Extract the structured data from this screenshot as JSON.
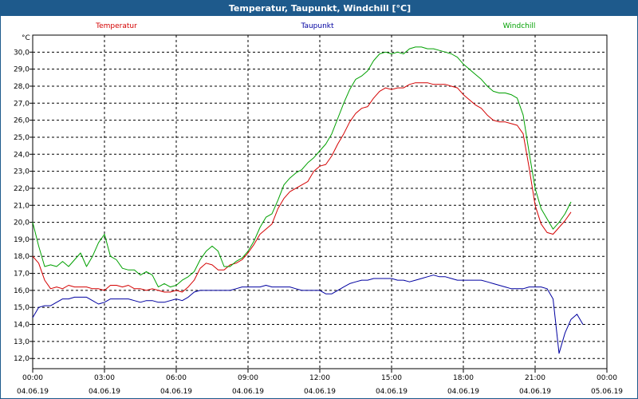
{
  "window": {
    "title": "Temperatur, Taupunkt, Windchill [°C]"
  },
  "colors": {
    "temperature": "#d40000",
    "dewpoint": "#0000a0",
    "windchill": "#00a000",
    "grid": "#000000",
    "titlebar": "#1e5a8c"
  },
  "chart_data": {
    "type": "line",
    "title": "Temperatur, Taupunkt, Windchill [°C]",
    "ylabel": "°C",
    "ylim": [
      11.4,
      31.0
    ],
    "xlim": [
      0,
      24
    ],
    "grid": true,
    "legend_position": "top",
    "y_ticks": [
      "12,0",
      "13,0",
      "14,0",
      "15,0",
      "16,0",
      "17,0",
      "18,0",
      "19,0",
      "20,0",
      "21,0",
      "22,0",
      "23,0",
      "24,0",
      "25,0",
      "26,0",
      "27,0",
      "28,0",
      "29,0",
      "30,0"
    ],
    "x_ticks": [
      {
        "time": "00:00",
        "date": "04.06.19"
      },
      {
        "time": "03:00",
        "date": "04.06.19"
      },
      {
        "time": "06:00",
        "date": "04.06.19"
      },
      {
        "time": "09:00",
        "date": "04.06.19"
      },
      {
        "time": "12:00",
        "date": "04.06.19"
      },
      {
        "time": "15:00",
        "date": "04.06.19"
      },
      {
        "time": "18:00",
        "date": "04.06.19"
      },
      {
        "time": "21:00",
        "date": "04.06.19"
      },
      {
        "time": "00:00",
        "date": "05.06.19"
      }
    ],
    "x_hours": [
      0,
      0.25,
      0.5,
      0.75,
      1,
      1.25,
      1.5,
      1.75,
      2,
      2.25,
      2.5,
      2.75,
      3,
      3.25,
      3.5,
      3.75,
      4,
      4.25,
      4.5,
      4.75,
      5,
      5.25,
      5.5,
      5.75,
      6,
      6.25,
      6.5,
      6.75,
      7,
      7.25,
      7.5,
      7.75,
      8,
      8.25,
      8.5,
      8.75,
      9,
      9.25,
      9.5,
      9.75,
      10,
      10.25,
      10.5,
      10.75,
      11,
      11.25,
      11.5,
      11.75,
      12,
      12.25,
      12.5,
      12.75,
      13,
      13.25,
      13.5,
      13.75,
      14,
      14.25,
      14.5,
      14.75,
      15,
      15.25,
      15.5,
      15.75,
      16,
      16.25,
      16.5,
      16.75,
      17,
      17.25,
      17.5,
      17.75,
      18,
      18.25,
      18.5,
      18.75,
      19,
      19.25,
      19.5,
      19.75,
      20,
      20.25,
      20.5,
      20.75,
      21,
      21.25,
      21.5,
      21.75,
      22,
      22.25,
      22.5,
      22.75,
      23,
      23.25,
      23.5,
      23.75,
      24
    ],
    "series": [
      {
        "name": "Temperatur",
        "color": "#d40000",
        "values": [
          18.0,
          17.6,
          16.6,
          16.1,
          16.2,
          16.1,
          16.3,
          16.2,
          16.2,
          16.2,
          16.1,
          16.1,
          16.0,
          16.3,
          16.3,
          16.2,
          16.3,
          16.1,
          16.1,
          16.0,
          16.1,
          16.0,
          15.9,
          15.9,
          16.0,
          15.9,
          16.2,
          16.6,
          17.3,
          17.6,
          17.5,
          17.2,
          17.2,
          17.5,
          17.6,
          17.8,
          18.2,
          18.7,
          19.3,
          19.6,
          19.9,
          20.8,
          21.4,
          21.8,
          22.0,
          22.2,
          22.4,
          23.0,
          23.3,
          23.4,
          23.9,
          24.6,
          25.2,
          25.9,
          26.4,
          26.7,
          26.8,
          27.3,
          27.7,
          27.9,
          27.8,
          27.9,
          27.9,
          28.1,
          28.2,
          28.2,
          28.2,
          28.1,
          28.1,
          28.1,
          28.0,
          27.9,
          27.5,
          27.2,
          26.9,
          26.7,
          26.3,
          26.0,
          25.9,
          25.9,
          25.8,
          25.7,
          25.2,
          23.2,
          21.0,
          19.9,
          19.4,
          19.3,
          19.7,
          20.1,
          20.6
        ]
      },
      {
        "name": "Taupunkt",
        "color": "#0000a0",
        "values": [
          14.4,
          15.0,
          15.1,
          15.1,
          15.3,
          15.5,
          15.5,
          15.6,
          15.6,
          15.6,
          15.4,
          15.2,
          15.3,
          15.5,
          15.5,
          15.5,
          15.5,
          15.4,
          15.3,
          15.4,
          15.4,
          15.3,
          15.3,
          15.4,
          15.5,
          15.4,
          15.6,
          15.9,
          16.0,
          16.0,
          16.0,
          16.0,
          16.0,
          16.0,
          16.1,
          16.2,
          16.2,
          16.2,
          16.2,
          16.3,
          16.2,
          16.2,
          16.2,
          16.2,
          16.1,
          16.0,
          16.0,
          16.0,
          16.0,
          15.8,
          15.8,
          16.0,
          16.2,
          16.4,
          16.5,
          16.6,
          16.6,
          16.7,
          16.7,
          16.7,
          16.7,
          16.6,
          16.6,
          16.5,
          16.6,
          16.7,
          16.8,
          16.9,
          16.8,
          16.8,
          16.7,
          16.6,
          16.6,
          16.6,
          16.6,
          16.6,
          16.5,
          16.4,
          16.3,
          16.2,
          16.1,
          16.1,
          16.1,
          16.2,
          16.2,
          16.2,
          16.1,
          15.5,
          12.3,
          13.5,
          14.3,
          14.6,
          14.0
        ]
      },
      {
        "name": "Windchill",
        "color": "#00a000",
        "values": [
          20.0,
          18.6,
          17.4,
          17.5,
          17.4,
          17.7,
          17.4,
          17.8,
          18.2,
          17.4,
          18.0,
          18.8,
          19.3,
          18.0,
          17.8,
          17.3,
          17.2,
          17.2,
          16.9,
          17.1,
          16.9,
          16.2,
          16.4,
          16.2,
          16.3,
          16.6,
          16.8,
          17.1,
          17.8,
          18.3,
          18.6,
          18.3,
          17.4,
          17.4,
          17.7,
          17.9,
          18.3,
          18.9,
          19.7,
          20.3,
          20.5,
          21.3,
          22.2,
          22.6,
          22.9,
          23.1,
          23.5,
          23.8,
          24.2,
          24.6,
          25.2,
          26.1,
          27.0,
          27.8,
          28.4,
          28.6,
          28.9,
          29.5,
          29.9,
          30.0,
          29.9,
          30.0,
          29.9,
          30.2,
          30.3,
          30.3,
          30.2,
          30.2,
          30.1,
          30.0,
          29.9,
          29.7,
          29.3,
          29.0,
          28.7,
          28.4,
          28.0,
          27.7,
          27.6,
          27.6,
          27.5,
          27.3,
          26.3,
          24.1,
          22.0,
          20.8,
          20.2,
          19.6,
          20.0,
          20.5,
          21.2
        ]
      }
    ]
  }
}
